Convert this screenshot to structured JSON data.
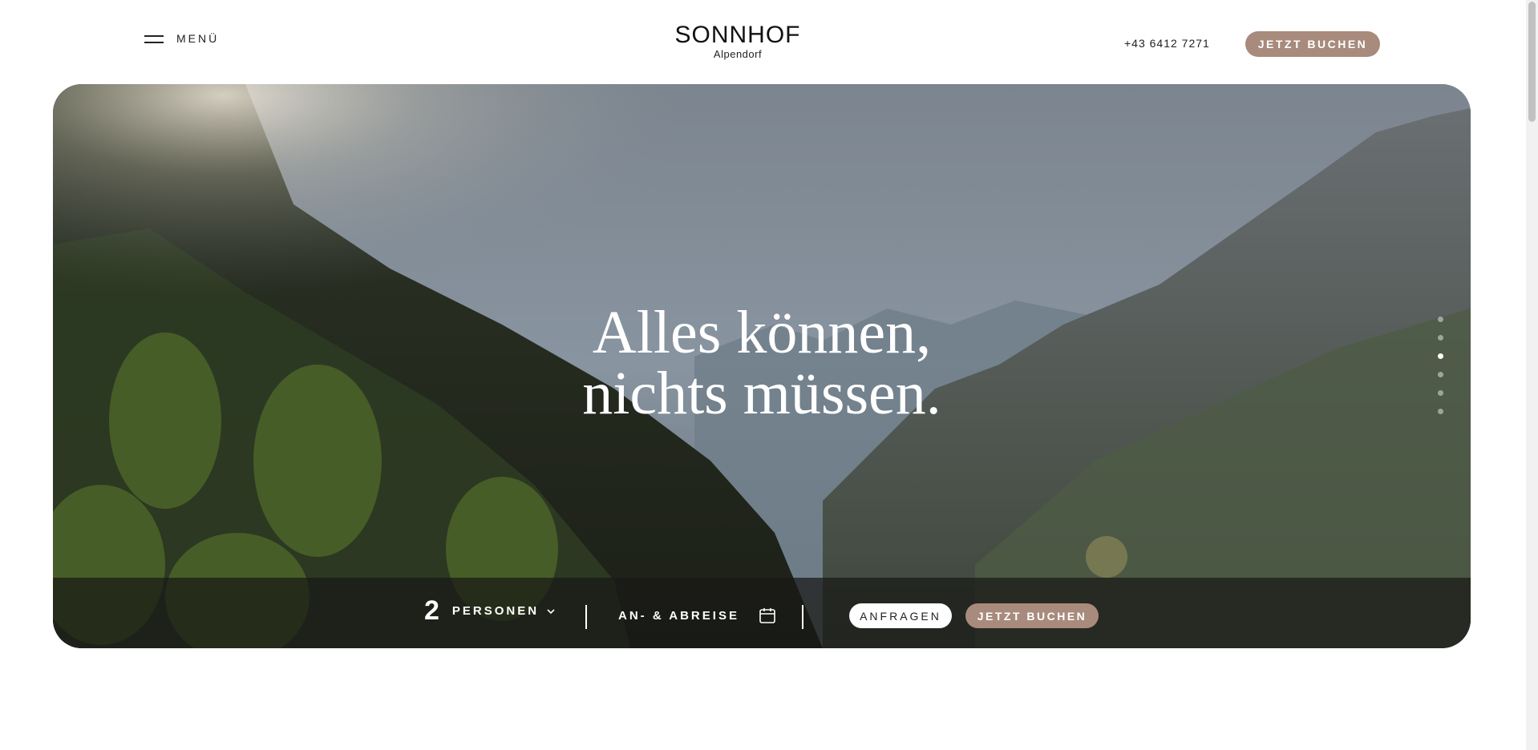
{
  "header": {
    "menu_label": "MENÜ",
    "logo_main": "SONNHOF",
    "logo_sub": "Alpendorf",
    "phone": "+43 6412 7271",
    "book_label": "JETZT BUCHEN"
  },
  "hero": {
    "headline_line1": "Alles können,",
    "headline_line2": "nichts müssen.",
    "slides": {
      "count": 6,
      "active_index": 2
    }
  },
  "booking": {
    "persons_count": "2",
    "persons_label": "PERSONEN",
    "dates_label": "AN- & ABREISE",
    "ask_label": "ANFRAGEN",
    "book_label": "JETZT BUCHEN"
  },
  "colors": {
    "accent": "#a88b7c",
    "overlay": "#191916",
    "text_dark": "#1a1a1a"
  },
  "icons": [
    "hamburger-menu-icon",
    "chevron-down-icon",
    "calendar-icon"
  ]
}
